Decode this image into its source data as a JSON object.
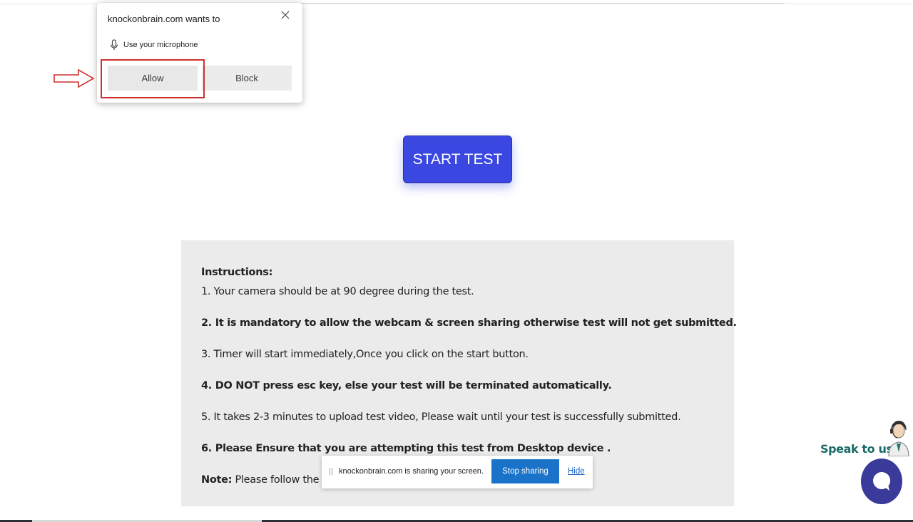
{
  "permission_popup": {
    "title": "knockonbrain.com wants to",
    "permission_text": "Use your microphone",
    "allow_label": "Allow",
    "block_label": "Block",
    "close_icon": "close-icon",
    "mic_icon": "microphone-icon"
  },
  "start_button": {
    "label": "START TEST",
    "color": "#3a47e0"
  },
  "instructions": {
    "heading": "Instructions:",
    "items": [
      "1. Your camera should be at 90 degree during the test.",
      "2. It is mandatory to allow the webcam & screen sharing otherwise test will not get submitted.",
      "3. Timer will start immediately,Once you click on the start button.",
      "4. DO NOT press esc key, else your test will be terminated automatically.",
      "5. It takes 2-3 minutes to upload test video, Please wait until your test is successfully submitted.",
      "6. Please Ensure that you are attempting this test from Desktop device ."
    ],
    "note_label": "Note:",
    "note_text": "Please follow the in"
  },
  "share_bar": {
    "grip": "||",
    "text": "knockonbrain.com is sharing your screen.",
    "stop_label": "Stop sharing",
    "hide_label": "Hide",
    "stop_color": "#1a73c8"
  },
  "speak": {
    "label": "Speak to us!",
    "chat_icon": "chat-bubble-icon",
    "avatar": "support-agent-avatar"
  }
}
